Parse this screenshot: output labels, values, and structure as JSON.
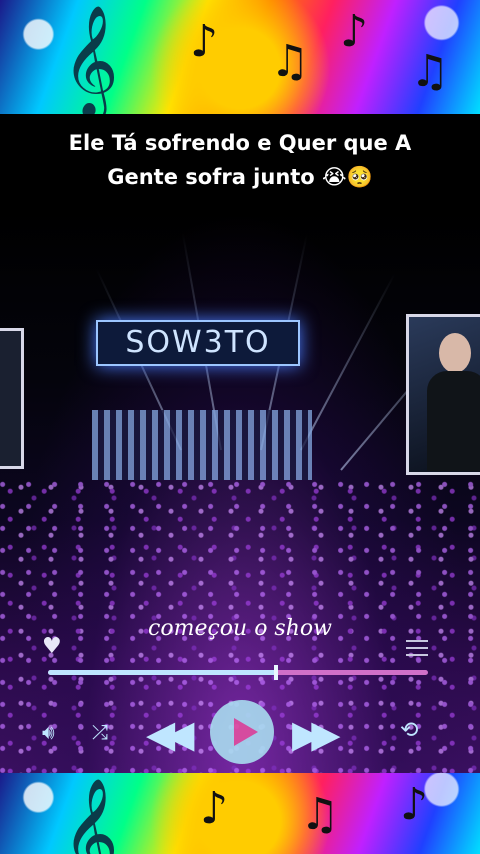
{
  "caption": {
    "line1": "Ele Tá sofrendo e Quer que A",
    "line2": "Gente sofra junto 😭🥺"
  },
  "video": {
    "stage_sign": "SOW3TO"
  },
  "player": {
    "song_title": "começou o show",
    "progress": 0.6,
    "icons": {
      "like": "heart-icon",
      "playlist": "menu-icon",
      "volume": "volume-icon",
      "shuffle": "shuffle-icon",
      "previous": "rewind-icon",
      "play": "play-icon",
      "next": "fast-forward-icon",
      "repeat": "repeat-icon"
    },
    "colors": {
      "accent": "#bfe6ff",
      "played": "#bfe6ff",
      "remaining": "#d070c8",
      "play_triangle": "#e050a0"
    }
  }
}
